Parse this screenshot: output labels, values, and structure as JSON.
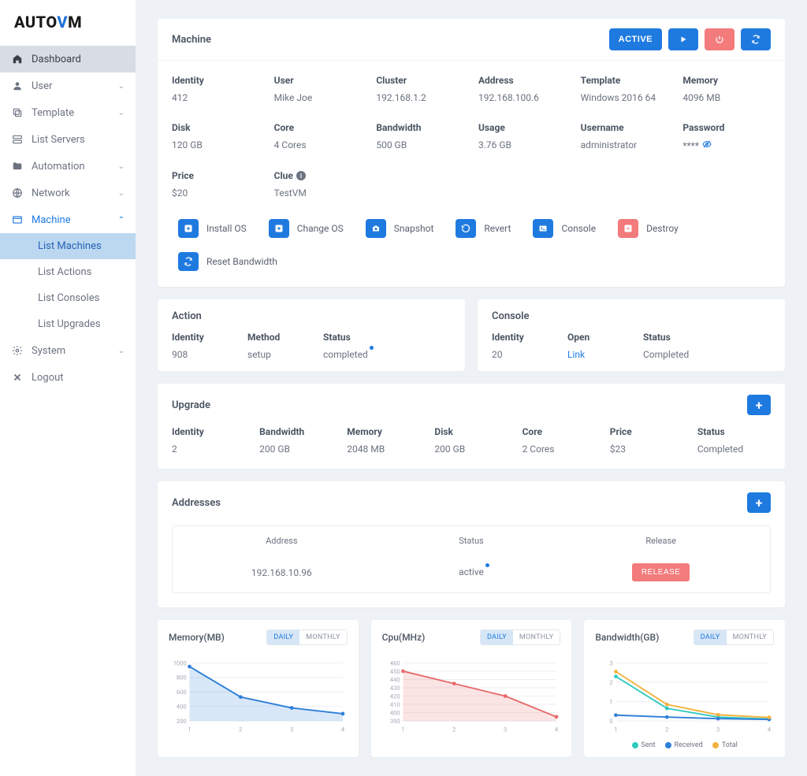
{
  "brand": {
    "part1": "AUTO",
    "part2": "V",
    "part3": "M"
  },
  "nav": {
    "dashboard": "Dashboard",
    "user": "User",
    "template": "Template",
    "list_servers": "List Servers",
    "automation": "Automation",
    "network": "Network",
    "machine": "Machine",
    "system": "System",
    "logout": "Logout",
    "sub": {
      "list_machines": "List Machines",
      "list_actions": "List Actions",
      "list_consoles": "List Consoles",
      "list_upgrades": "List Upgrades"
    }
  },
  "machine": {
    "title": "Machine",
    "status_btn": "ACTIVE",
    "props": {
      "identity": {
        "label": "Identity",
        "value": "412"
      },
      "user": {
        "label": "User",
        "value": "Mike Joe"
      },
      "cluster": {
        "label": "Cluster",
        "value": "192.168.1.2"
      },
      "address": {
        "label": "Address",
        "value": "192.168.100.6"
      },
      "template": {
        "label": "Template",
        "value": "Windows 2016 64"
      },
      "memory": {
        "label": "Memory",
        "value": "4096 MB"
      },
      "disk": {
        "label": "Disk",
        "value": "120 GB"
      },
      "core": {
        "label": "Core",
        "value": "4 Cores"
      },
      "bandwidth": {
        "label": "Bandwidth",
        "value": "500 GB"
      },
      "usage": {
        "label": "Usage",
        "value": "3.76 GB"
      },
      "username": {
        "label": "Username",
        "value": "administrator"
      },
      "password": {
        "label": "Password",
        "value": "****"
      },
      "price": {
        "label": "Price",
        "value": "$20"
      },
      "clue": {
        "label": "Clue",
        "value": "TestVM"
      }
    },
    "actions": {
      "install_os": "Install OS",
      "change_os": "Change OS",
      "snapshot": "Snapshot",
      "revert": "Revert",
      "console": "Console",
      "destroy": "Destroy",
      "reset_bw": "Reset Bandwidth"
    }
  },
  "action_panel": {
    "title": "Action",
    "identity": {
      "label": "Identity",
      "value": "908"
    },
    "method": {
      "label": "Method",
      "value": "setup"
    },
    "status": {
      "label": "Status",
      "value": "completed"
    }
  },
  "console_panel": {
    "title": "Console",
    "identity": {
      "label": "Identity",
      "value": "20"
    },
    "open": {
      "label": "Open",
      "value": "Link"
    },
    "status": {
      "label": "Status",
      "value": "Completed"
    }
  },
  "upgrade": {
    "title": "Upgrade",
    "identity": {
      "label": "Identity",
      "value": "2"
    },
    "bandwidth": {
      "label": "Bandwidth",
      "value": "200 GB"
    },
    "memory": {
      "label": "Memory",
      "value": "2048 MB"
    },
    "disk": {
      "label": "Disk",
      "value": "200 GB"
    },
    "core": {
      "label": "Core",
      "value": "2 Cores"
    },
    "price": {
      "label": "Price",
      "value": "$23"
    },
    "status": {
      "label": "Status",
      "value": "Completed"
    }
  },
  "addresses": {
    "title": "Addresses",
    "cols": {
      "address": "Address",
      "status": "Status",
      "release": "Release"
    },
    "row": {
      "address": "192.168.10.96",
      "status": "active",
      "release_btn": "RELEASE"
    }
  },
  "charts": {
    "daily": "DAILY",
    "monthly": "MONTHLY",
    "memory": {
      "title": "Memory(MB)"
    },
    "cpu": {
      "title": "Cpu(MHz)"
    },
    "bandwidth": {
      "title": "Bandwidth(GB)",
      "legend": {
        "sent": "Sent",
        "received": "Received",
        "total": "Total"
      }
    }
  },
  "chart_data": [
    {
      "type": "area",
      "title": "Memory(MB)",
      "x": [
        1,
        2,
        3,
        4
      ],
      "xlabel": "",
      "ylabel": "",
      "ylim": [
        200,
        1000
      ],
      "y_ticks": [
        200,
        400,
        600,
        800,
        1000
      ],
      "series": [
        {
          "name": "Memory",
          "values": [
            950,
            530,
            380,
            300
          ],
          "color": "#2f7fd8"
        }
      ]
    },
    {
      "type": "area",
      "title": "Cpu(MHz)",
      "x": [
        1,
        2,
        3,
        4
      ],
      "xlabel": "",
      "ylabel": "",
      "ylim": [
        390,
        460
      ],
      "y_ticks": [
        390,
        400,
        410,
        420,
        430,
        440,
        450,
        460
      ],
      "series": [
        {
          "name": "CPU",
          "values": [
            450,
            435,
            420,
            395
          ],
          "color": "#e86a6a"
        }
      ]
    },
    {
      "type": "line",
      "title": "Bandwidth(GB)",
      "x": [
        1,
        2,
        3,
        4
      ],
      "xlabel": "",
      "ylabel": "",
      "ylim": [
        0,
        3
      ],
      "y_ticks": [
        0.0,
        1.0,
        2.0,
        3.0
      ],
      "series": [
        {
          "name": "Sent",
          "values": [
            2.3,
            0.65,
            0.2,
            0.1
          ],
          "color": "#2fc9c0"
        },
        {
          "name": "Received",
          "values": [
            0.3,
            0.2,
            0.12,
            0.08
          ],
          "color": "#2f7fd8"
        },
        {
          "name": "Total",
          "values": [
            2.55,
            0.85,
            0.32,
            0.18
          ],
          "color": "#f3b23c"
        }
      ]
    }
  ]
}
